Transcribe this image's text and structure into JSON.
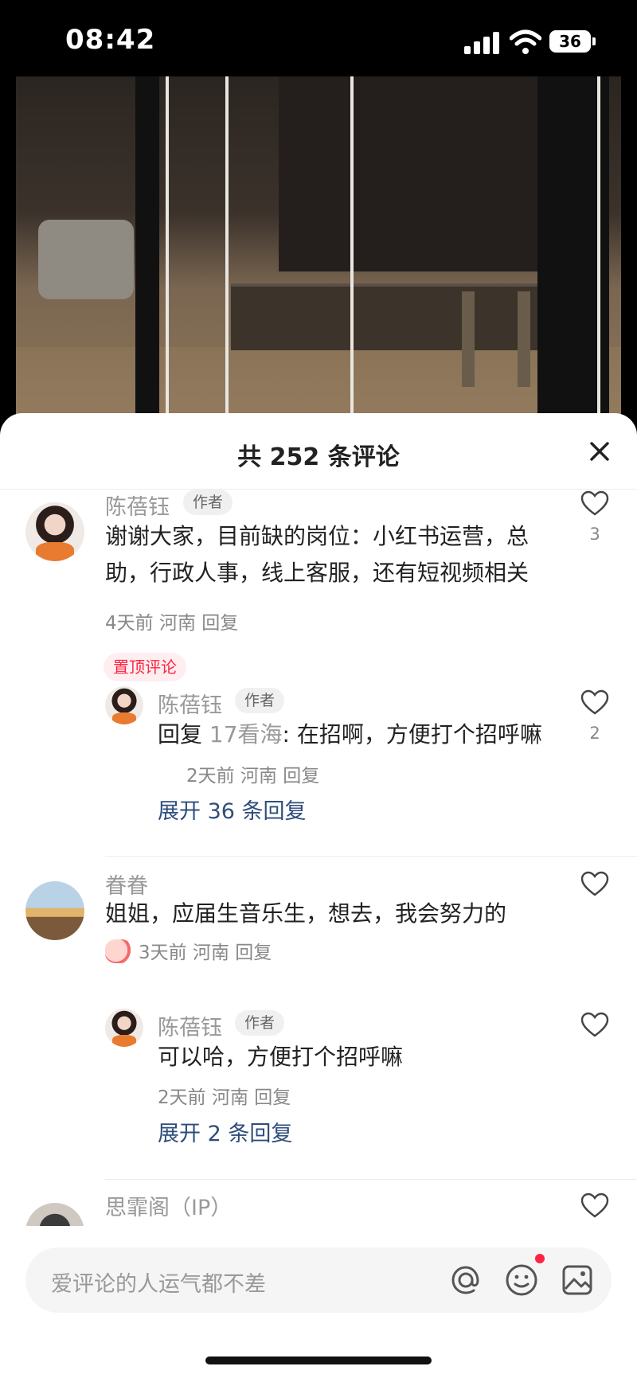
{
  "status_bar": {
    "time": "08:42",
    "battery": "36"
  },
  "sheet": {
    "title": "共 252 条评论",
    "close_icon": "close-icon"
  },
  "comments": [
    {
      "author": "陈蓓钰",
      "badge": "作者",
      "text": "谢谢大家，目前缺的岗位：小红书运营，总助，行政人事，线上客服，还有短视频相关",
      "meta": "4天前 河南 回复",
      "likes": "3",
      "pinned_label": "置顶评论",
      "reply": {
        "author": "陈蓓钰",
        "badge": "作者",
        "prefix": "回复 ",
        "mention": "17看海",
        "text": ": 在招啊，方便打个招呼嘛",
        "meta": "2天前 河南 回复",
        "likes": "2"
      },
      "expand": "展开 36 条回复"
    },
    {
      "author": "眷眷",
      "text": "姐姐，应届生音乐生，想去，我会努力的",
      "meta": "3天前 河南 回复",
      "reply": {
        "author": "陈蓓钰",
        "badge": "作者",
        "text": "可以哈，方便打个招呼嘛",
        "meta": "2天前 河南 回复"
      },
      "expand": "展开 2 条回复"
    },
    {
      "author": "思霏阁（IP）"
    }
  ],
  "input": {
    "placeholder": "爱评论的人运气都不差"
  },
  "colors": {
    "accent": "#ff2442",
    "link": "#2e4d7c",
    "muted": "#999999"
  }
}
